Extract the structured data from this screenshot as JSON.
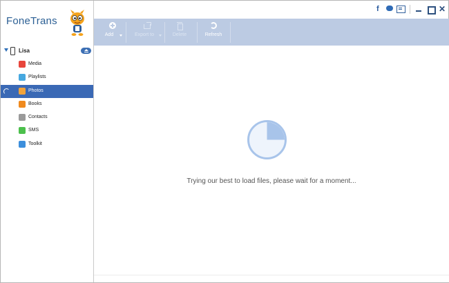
{
  "app": {
    "brand": "FoneTrans"
  },
  "device": {
    "name": "Lisa"
  },
  "sidebar": {
    "items": [
      {
        "label": "Media",
        "color": "#e8463c",
        "active": false
      },
      {
        "label": "Playlists",
        "color": "#46a8e0",
        "active": false
      },
      {
        "label": "Photos",
        "color": "#f2a33a",
        "active": true
      },
      {
        "label": "Books",
        "color": "#f08a1e",
        "active": false
      },
      {
        "label": "Contacts",
        "color": "#9a9a9a",
        "active": false
      },
      {
        "label": "SMS",
        "color": "#4cc04c",
        "active": false
      },
      {
        "label": "Toolkit",
        "color": "#3d8fdc",
        "active": false
      }
    ]
  },
  "toolbar": {
    "add_label": "Add",
    "export_label": "Export to",
    "delete_label": "Delete",
    "refresh_label": "Refresh"
  },
  "window_controls": {
    "facebook": "f",
    "close": "✕"
  },
  "content": {
    "loading_message": "Trying our best to load files, please wait for a moment...",
    "loading_progress": 0.25
  },
  "colors": {
    "accent": "#3a69b5",
    "toolbar": "#bccbe3",
    "loader": "#a8c4ea"
  }
}
